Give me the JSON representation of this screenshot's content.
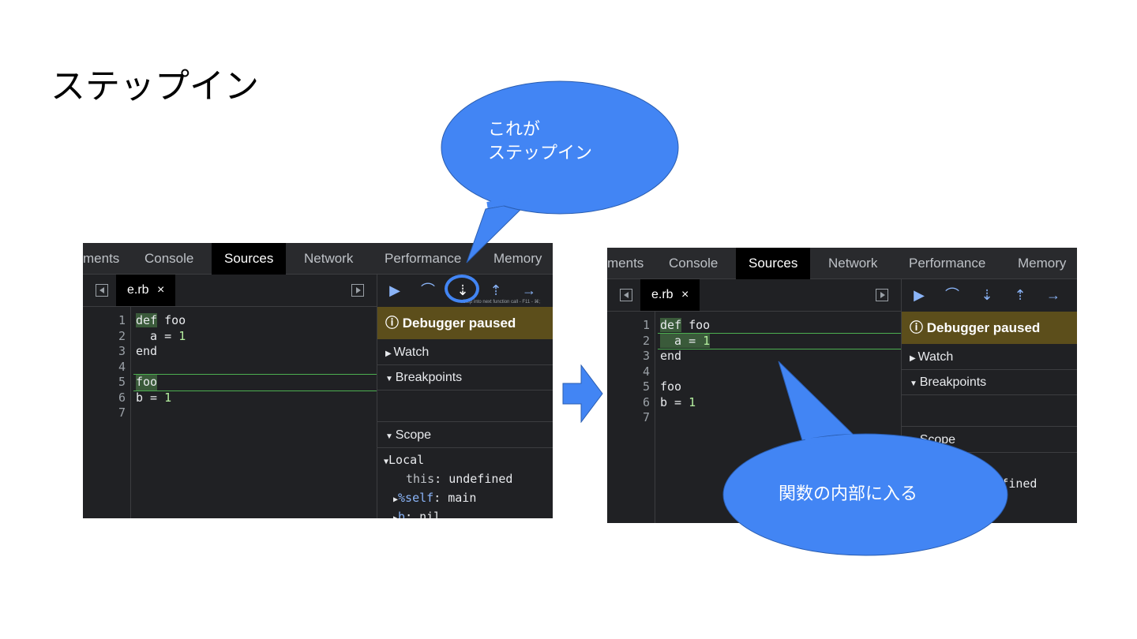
{
  "slide": {
    "title": "ステップイン"
  },
  "callouts": {
    "step_in": {
      "line1": "これが",
      "line2": "ステップイン"
    },
    "enter_function": "関数の内部に入る"
  },
  "devtools_tabs": [
    "ments",
    "Console",
    "Sources",
    "Network",
    "Performance",
    "Memory"
  ],
  "active_tab": "Sources",
  "file": {
    "name": "e.rb",
    "close": "×"
  },
  "code_lines": [
    {
      "n": "1",
      "text": "def foo"
    },
    {
      "n": "2",
      "text": "  a = 1"
    },
    {
      "n": "3",
      "text": "end"
    },
    {
      "n": "4",
      "text": ""
    },
    {
      "n": "5",
      "text": "foo"
    },
    {
      "n": "6",
      "text": "b = 1"
    },
    {
      "n": "7",
      "text": ""
    }
  ],
  "left_panel": {
    "exec_line": 5
  },
  "right_panel": {
    "exec_line": 2
  },
  "debugger": {
    "paused": "Debugger paused",
    "watch": "Watch",
    "breakpoints": "Breakpoints",
    "scope": "Scope",
    "local": "Local",
    "tooltip": "Step into next function call - F11 - ⌘;"
  },
  "scope_vars": {
    "this_key": "this",
    "this_val": "undefined",
    "self_key": "%self",
    "self_val": "main",
    "b_key": "b",
    "b_val": "nil"
  },
  "colors": {
    "accent_blue": "#4285f4",
    "paused_bar": "#5c4e1b",
    "exec_line": "#4caf50"
  }
}
